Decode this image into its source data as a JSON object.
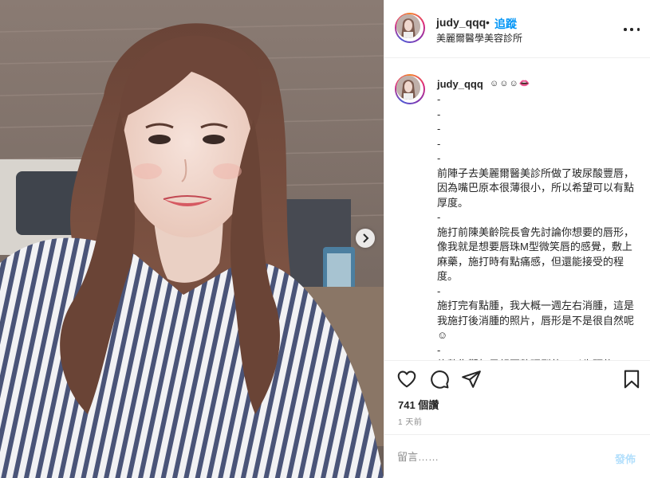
{
  "post": {
    "username": "judy_qqq",
    "follow_label": "追蹤",
    "separator": "•",
    "location": "美麗爾醫學美容診所"
  },
  "caption": {
    "username": "judy_qqq",
    "emoji": "☺☺☺👄",
    "text": "-\n-\n-\n-\n-\n前陣子去美麗爾醫美診所做了玻尿酸豐唇，因為嘴巴原本很薄很小，所以希望可以有點厚度。\n-\n施打前陳美齡院長會先討論你想要的唇形，像我就是想要唇珠M型微笑唇的感覺，敷上麻藥，施打時有點痛感，但還能接受的程度。\n-\n施打完有點腫，我大概一週左右消腫，這是我施打後消腫的照片，唇形是不是很自然呢☺\n-\n施整復觀如果想要整理型的可以先預約"
  },
  "stats": {
    "views": "741 個讚",
    "time": "1 天前"
  },
  "comment": {
    "placeholder": "留言……",
    "post_label": "發佈"
  },
  "icons": {
    "more": "more-icon",
    "like": "heart-icon",
    "comment": "comment-icon",
    "share": "share-icon",
    "save": "bookmark-icon",
    "next": "chevron-right-icon"
  },
  "colors": {
    "follow": "#0095f6",
    "post_disabled": "#b2dffc",
    "muted": "#8e8e8e",
    "text": "#262626"
  }
}
